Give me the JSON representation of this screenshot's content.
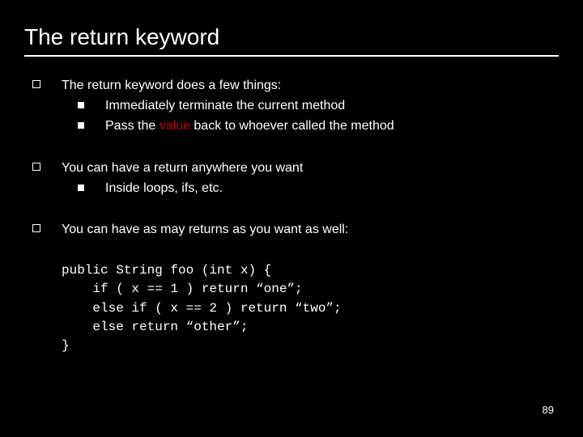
{
  "title": "The return keyword",
  "bullets": [
    {
      "text": "The return keyword does a few things:",
      "sub": [
        {
          "text": "Immediately terminate the current method"
        },
        {
          "prefix": "Pass the ",
          "red": "value",
          "suffix": " back to whoever called the method"
        }
      ]
    },
    {
      "text": "You can have a return anywhere you want",
      "sub": [
        {
          "text": "Inside loops, ifs, etc."
        }
      ]
    },
    {
      "text": "You can have as may returns as you want as well:",
      "sub": []
    }
  ],
  "code": {
    "l1": "public String foo (int x) {",
    "l2": "    if ( x == 1 ) return “one”;",
    "l3": "    else if ( x == 2 ) return “two”;",
    "l4": "    else return “other”;",
    "l5": "}"
  },
  "pagenum": "89"
}
